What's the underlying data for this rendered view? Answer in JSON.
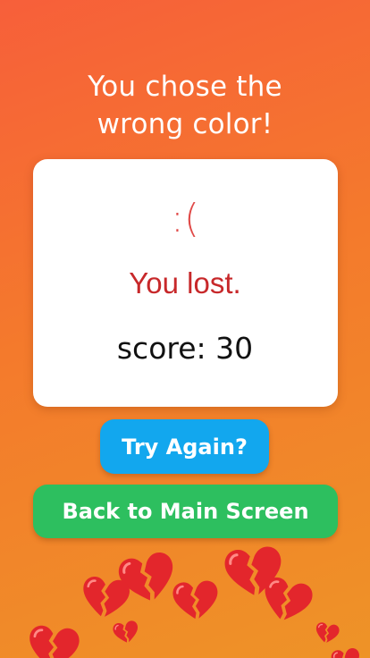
{
  "headline": {
    "line1": "You chose the",
    "line2": "wrong color!"
  },
  "card": {
    "face": ":(",
    "lost": "You lost.",
    "score": "score: 30"
  },
  "buttons": {
    "try_again": "Try Again?",
    "back": "Back to Main Screen"
  },
  "colors": {
    "background_top": "#f75f3a",
    "background_bottom": "#ee9327",
    "try_button": "#12a7ee",
    "back_button": "#2dbf5f",
    "face": "#e04a48",
    "lost": "#c7282a",
    "heart": "#e3262c"
  },
  "decorations": {
    "icon": "broken-heart-icon"
  }
}
